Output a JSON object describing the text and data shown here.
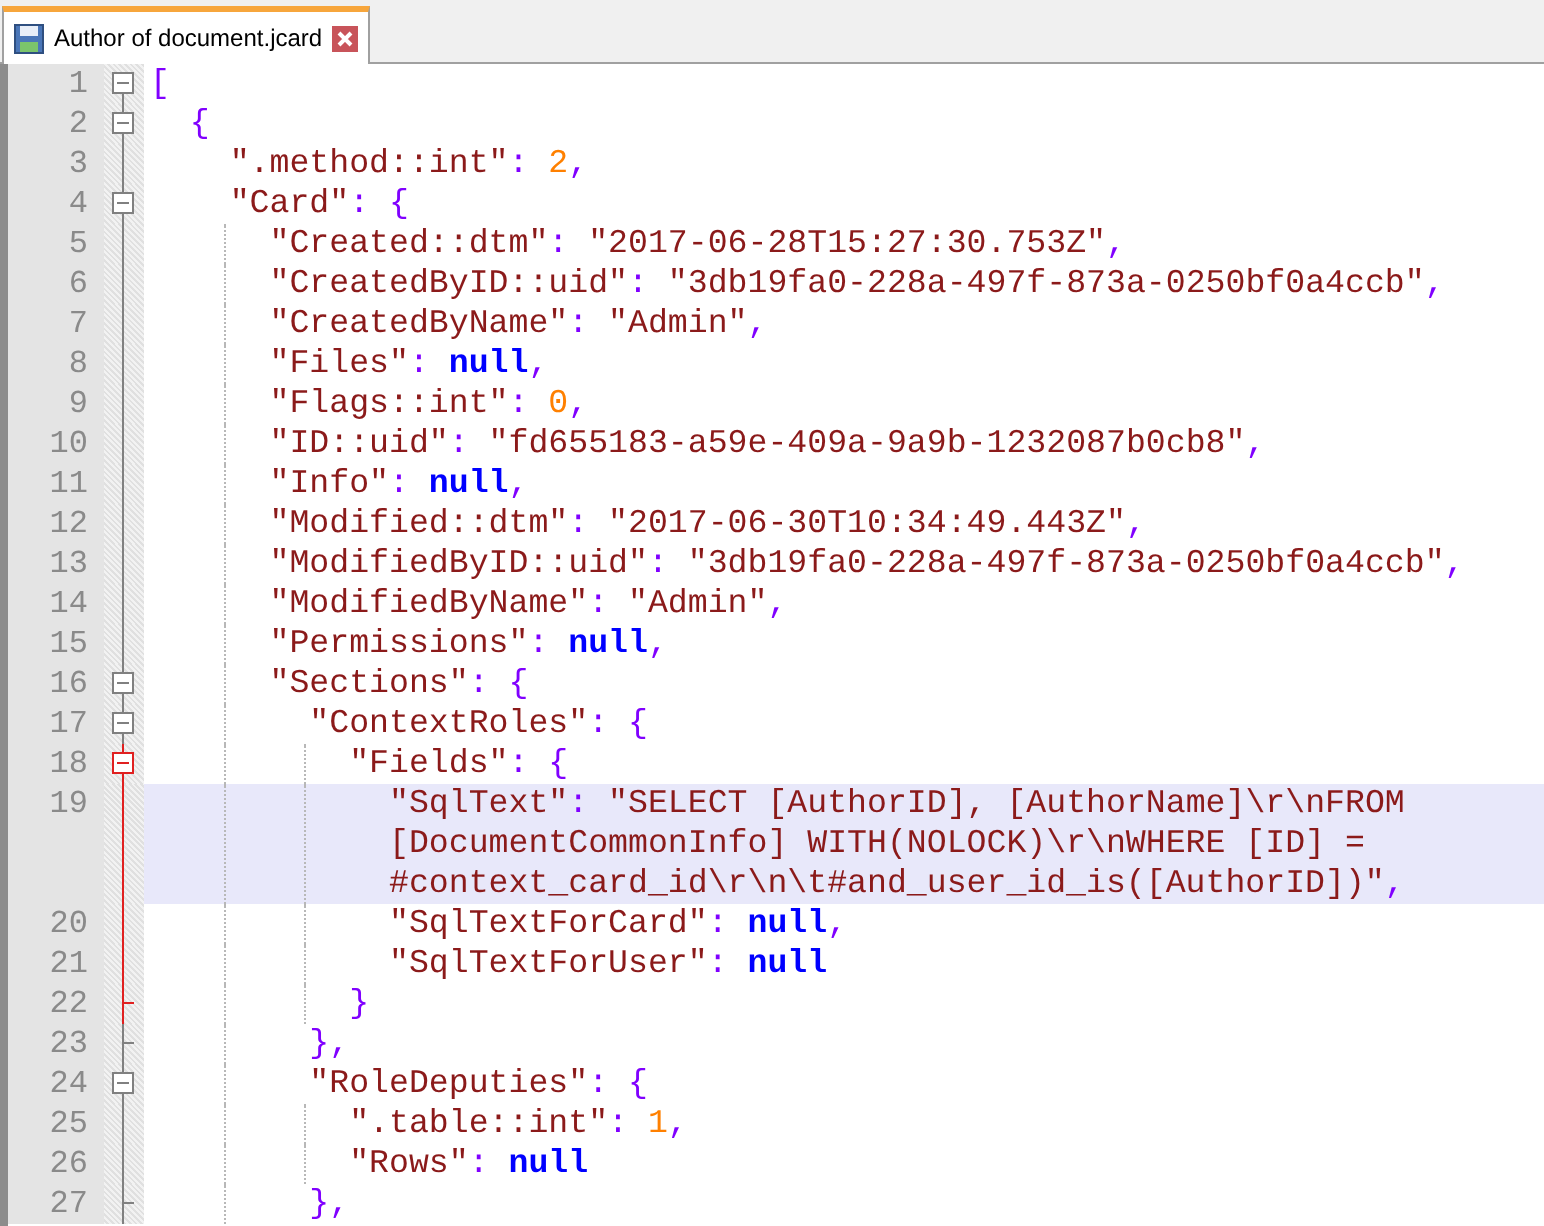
{
  "tab": {
    "label": "Author of document.jcard",
    "selected": true
  },
  "lines": [
    {
      "number": "1",
      "kind": "box",
      "active": false,
      "selected": false,
      "tokens": [
        {
          "kind": "punc",
          "text": "["
        }
      ]
    },
    {
      "number": "2",
      "kind": "box",
      "active": false,
      "selected": false,
      "tokens": [
        {
          "kind": "punc",
          "text": "  {"
        }
      ]
    },
    {
      "number": "3",
      "kind": "line",
      "active": false,
      "selected": false,
      "tokens": [
        {
          "kind": "key",
          "text": "    \".method::int\""
        },
        {
          "kind": "punc",
          "text": ": "
        },
        {
          "kind": "num",
          "text": "2"
        },
        {
          "kind": "punc",
          "text": ","
        }
      ]
    },
    {
      "number": "4",
      "kind": "box",
      "active": false,
      "selected": false,
      "tokens": [
        {
          "kind": "key",
          "text": "    \"Card\""
        },
        {
          "kind": "punc",
          "text": ": {"
        }
      ]
    },
    {
      "number": "5",
      "kind": "line",
      "active": false,
      "selected": false,
      "tokens": [
        {
          "kind": "key",
          "text": "      \"Created::dtm\""
        },
        {
          "kind": "punc",
          "text": ": "
        },
        {
          "kind": "str",
          "text": "\"2017-06-28T15:27:30.753Z\""
        },
        {
          "kind": "punc",
          "text": ","
        }
      ]
    },
    {
      "number": "6",
      "kind": "line",
      "active": false,
      "selected": false,
      "tokens": [
        {
          "kind": "key",
          "text": "      \"CreatedByID::uid\""
        },
        {
          "kind": "punc",
          "text": ": "
        },
        {
          "kind": "str",
          "text": "\"3db19fa0-228a-497f-873a-0250bf0a4ccb\""
        },
        {
          "kind": "punc",
          "text": ","
        }
      ]
    },
    {
      "number": "7",
      "kind": "line",
      "active": false,
      "selected": false,
      "tokens": [
        {
          "kind": "key",
          "text": "      \"CreatedByName\""
        },
        {
          "kind": "punc",
          "text": ": "
        },
        {
          "kind": "str",
          "text": "\"Admin\""
        },
        {
          "kind": "punc",
          "text": ","
        }
      ]
    },
    {
      "number": "8",
      "kind": "line",
      "active": false,
      "selected": false,
      "tokens": [
        {
          "kind": "key",
          "text": "      \"Files\""
        },
        {
          "kind": "punc",
          "text": ": "
        },
        {
          "kind": "null",
          "text": "null"
        },
        {
          "kind": "punc",
          "text": ","
        }
      ]
    },
    {
      "number": "9",
      "kind": "line",
      "active": false,
      "selected": false,
      "tokens": [
        {
          "kind": "key",
          "text": "      \"Flags::int\""
        },
        {
          "kind": "punc",
          "text": ": "
        },
        {
          "kind": "num",
          "text": "0"
        },
        {
          "kind": "punc",
          "text": ","
        }
      ]
    },
    {
      "number": "10",
      "kind": "line",
      "active": false,
      "selected": false,
      "tokens": [
        {
          "kind": "key",
          "text": "      \"ID::uid\""
        },
        {
          "kind": "punc",
          "text": ": "
        },
        {
          "kind": "str",
          "text": "\"fd655183-a59e-409a-9a9b-1232087b0cb8\""
        },
        {
          "kind": "punc",
          "text": ","
        }
      ]
    },
    {
      "number": "11",
      "kind": "line",
      "active": false,
      "selected": false,
      "tokens": [
        {
          "kind": "key",
          "text": "      \"Info\""
        },
        {
          "kind": "punc",
          "text": ": "
        },
        {
          "kind": "null",
          "text": "null"
        },
        {
          "kind": "punc",
          "text": ","
        }
      ]
    },
    {
      "number": "12",
      "kind": "line",
      "active": false,
      "selected": false,
      "tokens": [
        {
          "kind": "key",
          "text": "      \"Modified::dtm\""
        },
        {
          "kind": "punc",
          "text": ": "
        },
        {
          "kind": "str",
          "text": "\"2017-06-30T10:34:49.443Z\""
        },
        {
          "kind": "punc",
          "text": ","
        }
      ]
    },
    {
      "number": "13",
      "kind": "line",
      "active": false,
      "selected": false,
      "tokens": [
        {
          "kind": "key",
          "text": "      \"ModifiedByID::uid\""
        },
        {
          "kind": "punc",
          "text": ": "
        },
        {
          "kind": "str",
          "text": "\"3db19fa0-228a-497f-873a-0250bf0a4ccb\""
        },
        {
          "kind": "punc",
          "text": ","
        }
      ]
    },
    {
      "number": "14",
      "kind": "line",
      "active": false,
      "selected": false,
      "tokens": [
        {
          "kind": "key",
          "text": "      \"ModifiedByName\""
        },
        {
          "kind": "punc",
          "text": ": "
        },
        {
          "kind": "str",
          "text": "\"Admin\""
        },
        {
          "kind": "punc",
          "text": ","
        }
      ]
    },
    {
      "number": "15",
      "kind": "line",
      "active": false,
      "selected": false,
      "tokens": [
        {
          "kind": "key",
          "text": "      \"Permissions\""
        },
        {
          "kind": "punc",
          "text": ": "
        },
        {
          "kind": "null",
          "text": "null"
        },
        {
          "kind": "punc",
          "text": ","
        }
      ]
    },
    {
      "number": "16",
      "kind": "box",
      "active": false,
      "selected": false,
      "tokens": [
        {
          "kind": "key",
          "text": "      \"Sections\""
        },
        {
          "kind": "punc",
          "text": ": {"
        }
      ]
    },
    {
      "number": "17",
      "kind": "box",
      "active": false,
      "selected": false,
      "tokens": [
        {
          "kind": "key",
          "text": "        \"ContextRoles\""
        },
        {
          "kind": "punc",
          "text": ": {"
        }
      ]
    },
    {
      "number": "18",
      "kind": "box",
      "active": true,
      "selected": false,
      "tokens": [
        {
          "kind": "key",
          "text": "          \"Fields\""
        },
        {
          "kind": "punc",
          "text": ": {"
        }
      ]
    },
    {
      "number": "19",
      "kind": "line",
      "active": true,
      "selected": true,
      "tokens": [
        {
          "kind": "key",
          "text": "            \"SqlText\""
        },
        {
          "kind": "punc",
          "text": ": "
        },
        {
          "kind": "str",
          "text": "\"SELECT [AuthorID], [AuthorName]\\r\\nFROM"
        }
      ],
      "wrap": [
        [
          {
            "kind": "str",
            "text": "            [DocumentCommonInfo] WITH(NOLOCK)\\r\\nWHERE [ID] ="
          }
        ],
        [
          {
            "kind": "str",
            "text": "            #context_card_id\\r\\n\\t#and_user_id_is([AuthorID])\""
          },
          {
            "kind": "punc",
            "text": ","
          }
        ]
      ]
    },
    {
      "number": "20",
      "kind": "line",
      "active": true,
      "selected": false,
      "tokens": [
        {
          "kind": "key",
          "text": "            \"SqlTextForCard\""
        },
        {
          "kind": "punc",
          "text": ": "
        },
        {
          "kind": "null",
          "text": "null"
        },
        {
          "kind": "punc",
          "text": ","
        }
      ]
    },
    {
      "number": "21",
      "kind": "line",
      "active": true,
      "selected": false,
      "tokens": [
        {
          "kind": "key",
          "text": "            \"SqlTextForUser\""
        },
        {
          "kind": "punc",
          "text": ": "
        },
        {
          "kind": "null",
          "text": "null"
        }
      ]
    },
    {
      "number": "22",
      "kind": "end",
      "active": true,
      "selected": false,
      "tokens": [
        {
          "kind": "punc",
          "text": "          }"
        }
      ]
    },
    {
      "number": "23",
      "kind": "end",
      "active": false,
      "selected": false,
      "tokens": [
        {
          "kind": "punc",
          "text": "        },"
        }
      ]
    },
    {
      "number": "24",
      "kind": "box",
      "active": false,
      "selected": false,
      "tokens": [
        {
          "kind": "key",
          "text": "        \"RoleDeputies\""
        },
        {
          "kind": "punc",
          "text": ": {"
        }
      ]
    },
    {
      "number": "25",
      "kind": "line",
      "active": false,
      "selected": false,
      "tokens": [
        {
          "kind": "key",
          "text": "          \".table::int\""
        },
        {
          "kind": "punc",
          "text": ": "
        },
        {
          "kind": "num",
          "text": "1"
        },
        {
          "kind": "punc",
          "text": ","
        }
      ]
    },
    {
      "number": "26",
      "kind": "line",
      "active": false,
      "selected": false,
      "tokens": [
        {
          "kind": "key",
          "text": "          \"Rows\""
        },
        {
          "kind": "punc",
          "text": ": "
        },
        {
          "kind": "null",
          "text": "null"
        }
      ]
    },
    {
      "number": "27",
      "kind": "end",
      "active": false,
      "selected": false,
      "tokens": [
        {
          "kind": "punc",
          "text": "        },"
        }
      ]
    }
  ]
}
